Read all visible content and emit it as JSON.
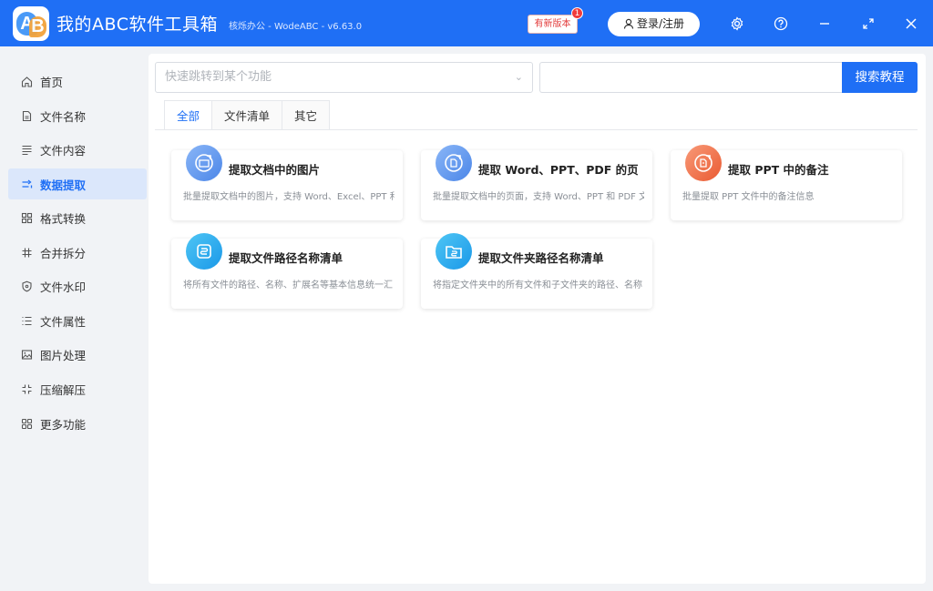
{
  "titlebar": {
    "app_name": "我的ABC软件工具箱",
    "subtitle": "核烁办公 - WodeABC - v6.63.0",
    "new_version_label": "有新版本",
    "new_version_badge": "1",
    "login_label": "登录/注册",
    "logo_a": "A",
    "logo_b": "B"
  },
  "sidebar": {
    "items": [
      {
        "label": "首页",
        "icon": "home-icon"
      },
      {
        "label": "文件名称",
        "icon": "file-name-icon"
      },
      {
        "label": "文件内容",
        "icon": "file-content-icon"
      },
      {
        "label": "数据提取",
        "icon": "data-extract-icon",
        "active": true
      },
      {
        "label": "格式转换",
        "icon": "format-convert-icon"
      },
      {
        "label": "合并拆分",
        "icon": "merge-split-icon"
      },
      {
        "label": "文件水印",
        "icon": "watermark-icon"
      },
      {
        "label": "文件属性",
        "icon": "file-attr-icon"
      },
      {
        "label": "图片处理",
        "icon": "image-icon"
      },
      {
        "label": "压缩解压",
        "icon": "compress-icon"
      },
      {
        "label": "更多功能",
        "icon": "more-icon"
      }
    ]
  },
  "search": {
    "placeholder": "快速跳转到某个功能",
    "button_label": "搜索教程"
  },
  "tabs": [
    {
      "label": "全部",
      "active": true
    },
    {
      "label": "文件清单"
    },
    {
      "label": "其它"
    }
  ],
  "cards": [
    {
      "title": "提取文档中的图片",
      "desc": "批量提取文档中的图片，支持 Word、Excel、PPT 和",
      "icon": "image-extract-icon"
    },
    {
      "title": "提取 Word、PPT、PDF 的页",
      "desc": "批量提取文档中的页面，支持 Word、PPT 和 PDF 文",
      "icon": "page-extract-icon"
    },
    {
      "title": "提取 PPT 中的备注",
      "desc": "批量提取 PPT 文件中的备注信息",
      "icon": "ppt-notes-icon"
    },
    {
      "title": "提取文件路径名称清单",
      "desc": "将所有文件的路径、名称、扩展名等基本信息统一汇",
      "icon": "file-path-list-icon"
    },
    {
      "title": "提取文件夹路径名称清单",
      "desc": "将指定文件夹中的所有文件和子文件夹的路径、名称",
      "icon": "folder-path-list-icon"
    }
  ],
  "colors": {
    "brand": "#1f6ff5",
    "active_nav_bg": "#dbe7fb",
    "notes_icon": "#f06a3f"
  }
}
